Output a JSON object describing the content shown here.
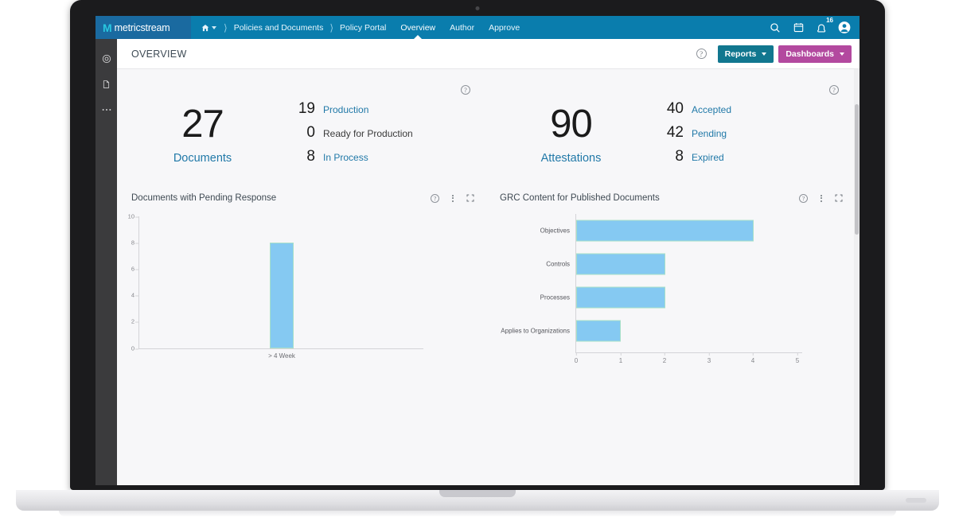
{
  "brand": {
    "mark": "M",
    "name": "metricstream"
  },
  "topnav": {
    "home_icon": "home-icon",
    "breadcrumbs": [
      "Policies and Documents",
      "Policy Portal"
    ],
    "tabs": [
      {
        "label": "Overview",
        "active": true
      },
      {
        "label": "Author",
        "active": false
      },
      {
        "label": "Approve",
        "active": false
      }
    ],
    "icons": [
      {
        "name": "search-icon",
        "glyph": "search"
      },
      {
        "name": "calendar-icon",
        "glyph": "calendar"
      },
      {
        "name": "notifications-icon",
        "glyph": "bell",
        "badge": "16"
      },
      {
        "name": "user-avatar-icon",
        "glyph": "user"
      }
    ]
  },
  "rail": {
    "items": [
      {
        "name": "target-icon"
      },
      {
        "name": "document-icon"
      },
      {
        "name": "more-icon",
        "label": "..."
      }
    ]
  },
  "toolbar": {
    "title": "OVERVIEW",
    "help_label": "?",
    "reports_label": "Reports",
    "dashboards_label": "Dashboards",
    "reports_color": "#11778f",
    "dashboards_color": "#b3499f"
  },
  "kpis": [
    {
      "value": "27",
      "label": "Documents",
      "help_label": "?",
      "items": [
        {
          "value": "19",
          "label": "Production",
          "link": true
        },
        {
          "value": "0",
          "label": "Ready for Production",
          "link": false
        },
        {
          "value": "8",
          "label": "In Process",
          "link": true
        }
      ]
    },
    {
      "value": "90",
      "label": "Attestations",
      "help_label": "?",
      "items": [
        {
          "value": "40",
          "label": "Accepted",
          "link": true
        },
        {
          "value": "42",
          "label": "Pending",
          "link": true
        },
        {
          "value": "8",
          "label": "Expired",
          "link": true
        }
      ]
    }
  ],
  "panels": [
    {
      "title": "Documents with Pending Response",
      "help_label": "?"
    },
    {
      "title": "GRC Content for Published Documents",
      "help_label": "?"
    }
  ],
  "chart_data": [
    {
      "type": "bar",
      "title": "Documents with Pending Response",
      "orientation": "vertical",
      "categories": [
        "> 4 Week"
      ],
      "values": [
        8
      ],
      "xlabel": "",
      "ylabel": "",
      "ylim": [
        0,
        10
      ],
      "yticks": [
        0,
        2,
        4,
        6,
        8,
        10
      ],
      "grid": false,
      "legend": "none",
      "bar_color": "#85c9f2"
    },
    {
      "type": "bar",
      "title": "GRC Content for Published Documents",
      "orientation": "horizontal",
      "categories": [
        "Objectives",
        "Controls",
        "Processes",
        "Applies to Organizations"
      ],
      "values": [
        4,
        2,
        2,
        1
      ],
      "xlabel": "",
      "ylabel": "",
      "xlim": [
        0,
        5
      ],
      "xticks": [
        0,
        1,
        2,
        3,
        4,
        5
      ],
      "grid": false,
      "legend": "none",
      "bar_color": "#85c9f2"
    }
  ]
}
